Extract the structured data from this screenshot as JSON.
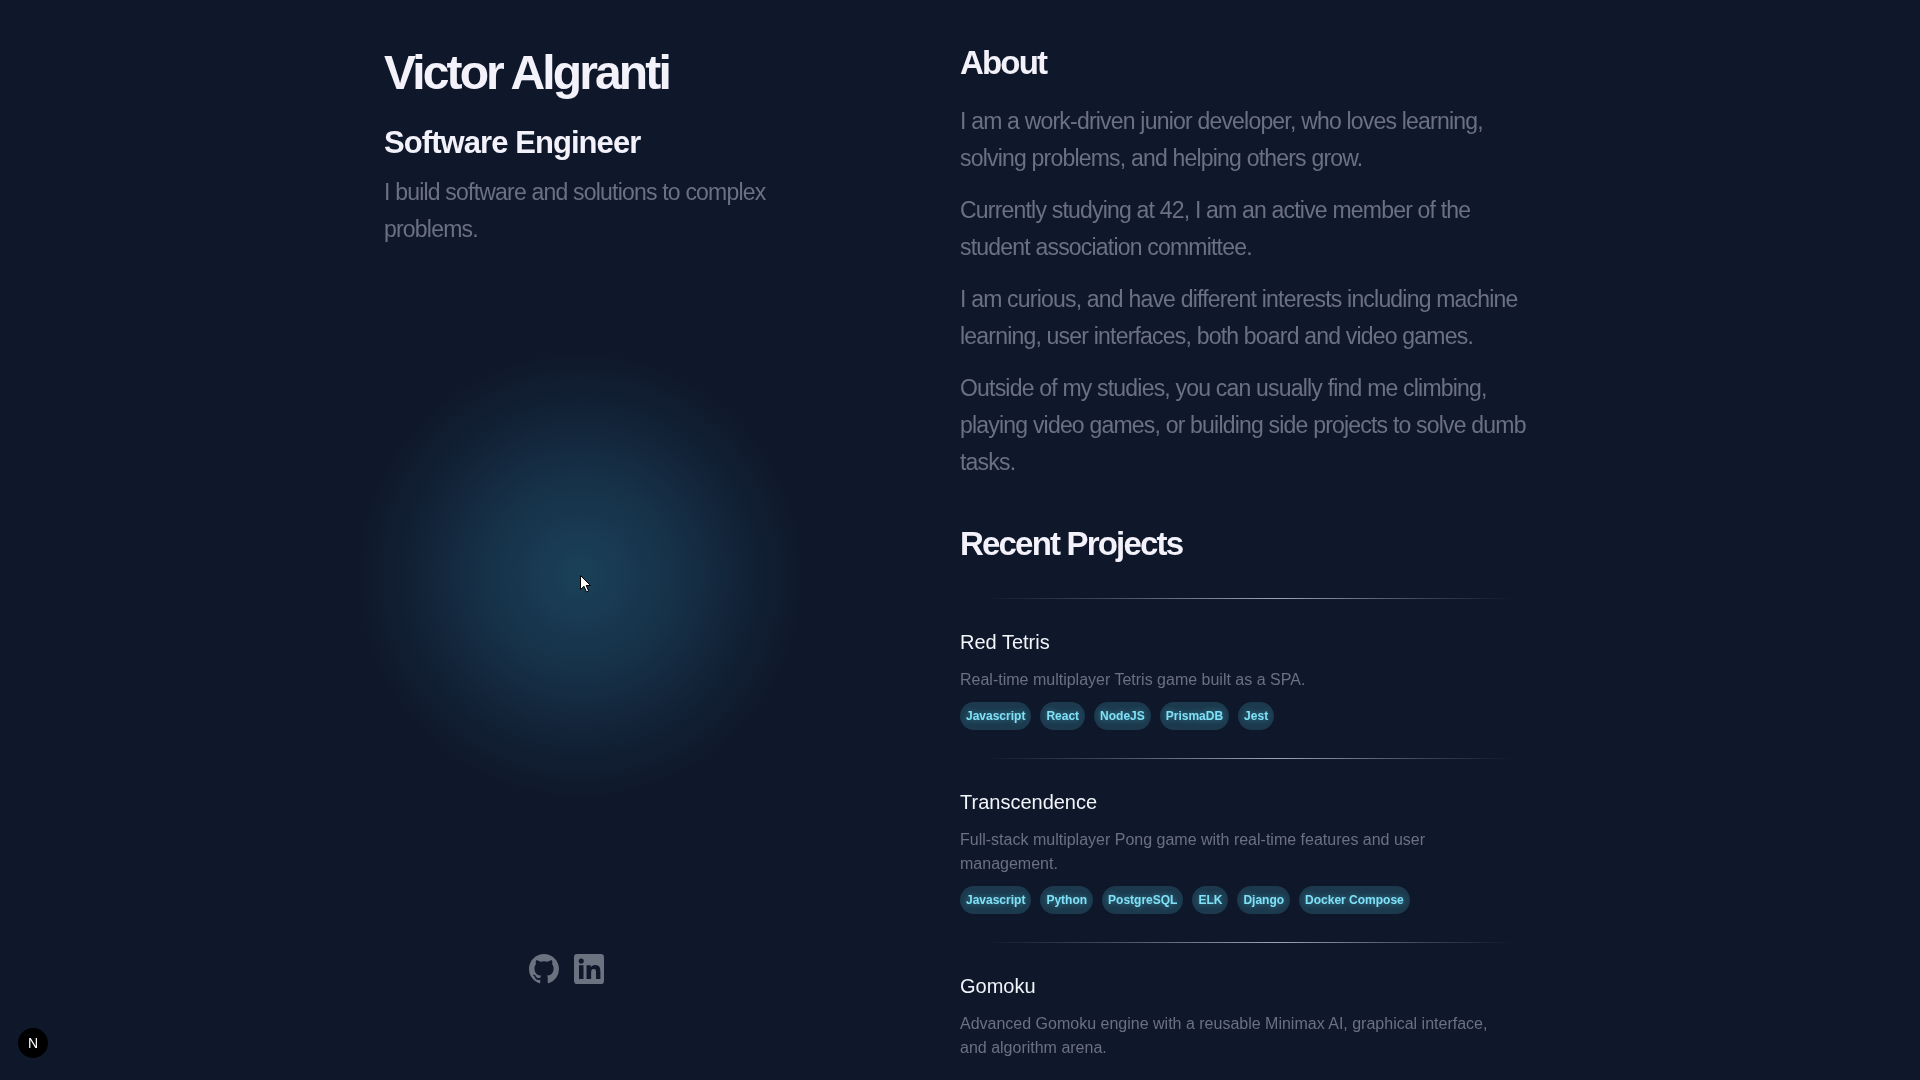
{
  "profile": {
    "name": "Victor Algranti",
    "role": "Software Engineer",
    "tagline": "I build software and solutions to complex problems."
  },
  "social_links": [
    {
      "kind": "github"
    },
    {
      "kind": "linkedin"
    }
  ],
  "about": {
    "heading": "About",
    "paragraphs": [
      "I am a work-driven junior developer, who loves learning, solving problems, and helping others grow.",
      "Currently studying at 42, I am an active member of the student association committee.",
      "I am curious, and have different interests including machine learning, user interfaces, both board and video games.",
      "Outside of my studies, you can usually find me climbing, playing video games, or building side projects to solve dumb tasks."
    ]
  },
  "projects": {
    "heading": "Recent Projects",
    "items": [
      {
        "title": "Red Tetris",
        "description": "Real-time multiplayer Tetris game built as a SPA.",
        "tags": [
          "Javascript",
          "React",
          "NodeJS",
          "PrismaDB",
          "Jest"
        ]
      },
      {
        "title": "Transcendence",
        "description": "Full-stack multiplayer Pong game with real-time features and user management.",
        "tags": [
          "Javascript",
          "Python",
          "PostgreSQL",
          "ELK",
          "Django",
          "Docker Compose"
        ]
      },
      {
        "title": "Gomoku",
        "description": "Advanced Gomoku engine with a reusable Minimax AI, graphical interface, and algorithm arena."
      }
    ]
  },
  "dev_indicator": {
    "label": "N"
  }
}
